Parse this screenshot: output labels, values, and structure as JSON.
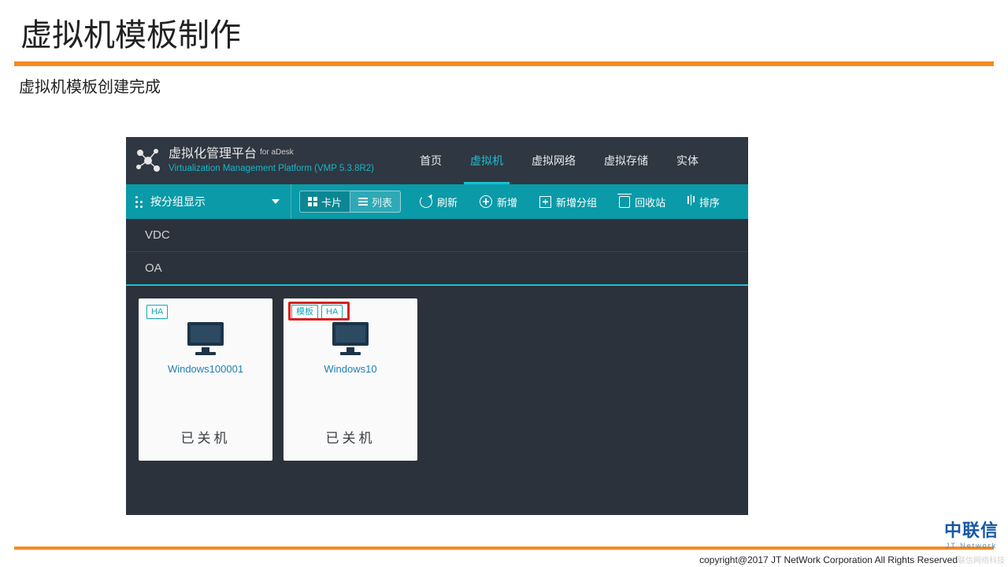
{
  "slide": {
    "title": "虚拟机模板制作",
    "subtitle": "虚拟机模板创建完成"
  },
  "app": {
    "header": {
      "title": "虚拟化管理平台",
      "for": "for aDesk",
      "subtitle": "Virtualization Management Platform (VMP 5.3.8R2)"
    },
    "nav": {
      "items": [
        "首页",
        "虚拟机",
        "虚拟网络",
        "虚拟存储",
        "实体"
      ],
      "active_index": 1
    },
    "toolbar": {
      "group_display": "按分组显示",
      "view_card": "卡片",
      "view_list": "列表",
      "refresh": "刷新",
      "add": "新增",
      "add_group": "新增分组",
      "recycle": "回收站",
      "sort": "排序"
    },
    "groups": [
      "VDC",
      "OA"
    ],
    "tags": {
      "ha": "HA",
      "template": "模板"
    },
    "cards": [
      {
        "name": "Windows100001",
        "status": "已关机",
        "tags": [
          "HA"
        ],
        "highlight": false
      },
      {
        "name": "Windows10",
        "status": "已关机",
        "tags": [
          "模板",
          "HA"
        ],
        "highlight": true
      }
    ]
  },
  "footer": {
    "jt_cn": "中联信",
    "jt_en": "JT Network",
    "copyright": "copyright@2017  JT NetWork Corporation All Rights Reserved",
    "watermark": "中联信网络科技"
  }
}
